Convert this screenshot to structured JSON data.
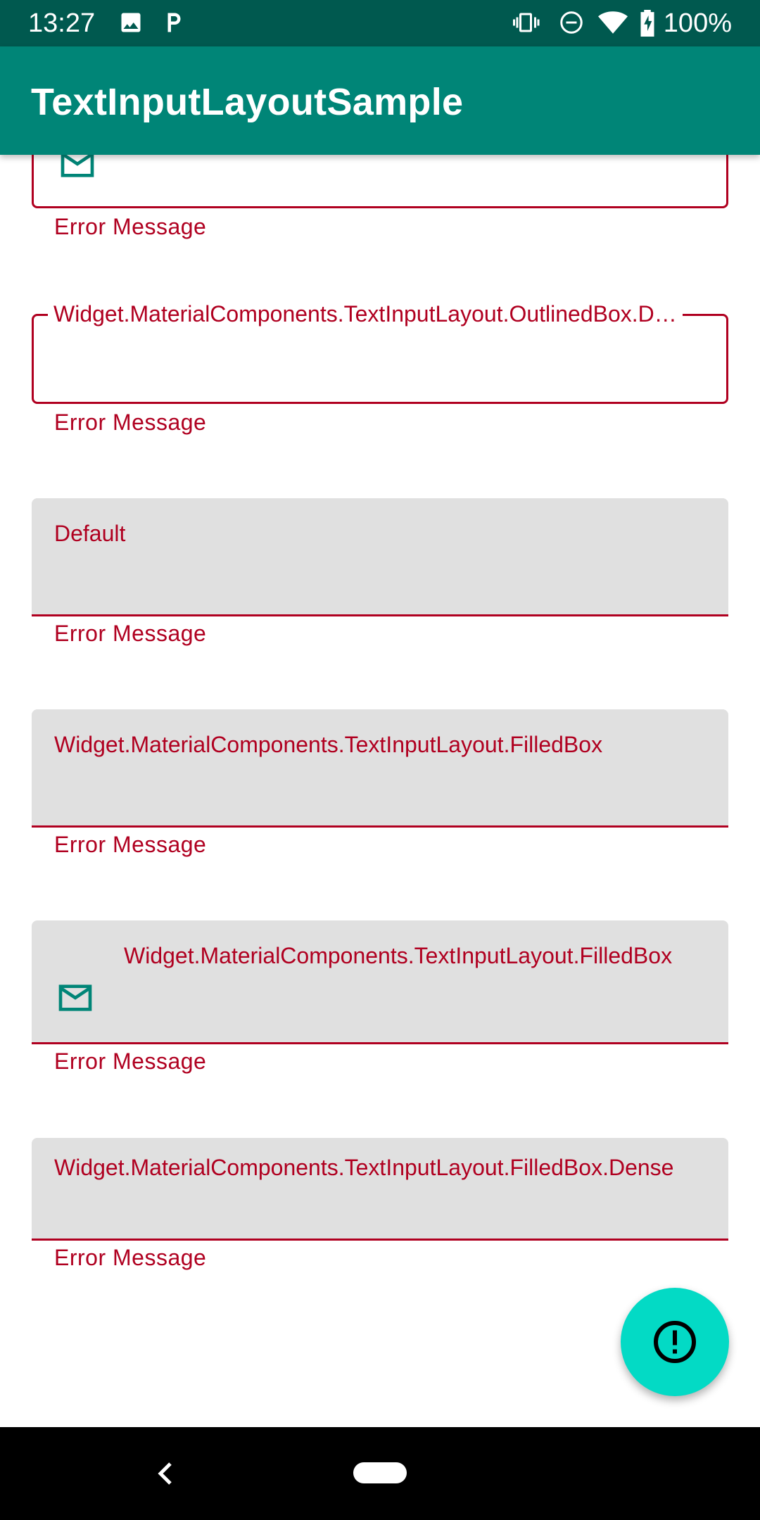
{
  "status_bar": {
    "time": "13:27",
    "battery": "100%",
    "icons": [
      "image-icon",
      "parking-icon",
      "vibrate-icon",
      "do-not-disturb-icon",
      "wifi-icon",
      "battery-charging-icon"
    ]
  },
  "app_bar": {
    "title": "TextInputLayoutSample"
  },
  "fields": [
    {
      "style": "outlined-with-icon",
      "label": "",
      "icon": "email-icon",
      "error": "Error Message"
    },
    {
      "style": "outlined-dense",
      "label": "Widget.MaterialComponents.TextInputLayout.OutlinedBox.D…",
      "error": "Error Message"
    },
    {
      "style": "filled-default",
      "label": "Default",
      "error": "Error Message"
    },
    {
      "style": "filled",
      "label": "Widget.MaterialComponents.TextInputLayout.FilledBox",
      "error": "Error Message"
    },
    {
      "style": "filled-with-icon",
      "label": "Widget.MaterialComponents.TextInputLayout.FilledBox",
      "icon": "email-icon",
      "error": "Error Message"
    },
    {
      "style": "filled-dense",
      "label": "Widget.MaterialComponents.TextInputLayout.FilledBox.Dense",
      "error": "Error Message"
    }
  ],
  "fab": {
    "icon": "error-outline-icon"
  },
  "nav_bar": {
    "back_icon": "back-chevron-icon",
    "home_icon": "home-pill-icon"
  },
  "colors": {
    "status_bar": "#00594f",
    "app_bar": "#008577",
    "error": "#b00020",
    "accent": "#03dac5",
    "icon_tint": "#008577",
    "filled_background": "#e0e0e0"
  }
}
